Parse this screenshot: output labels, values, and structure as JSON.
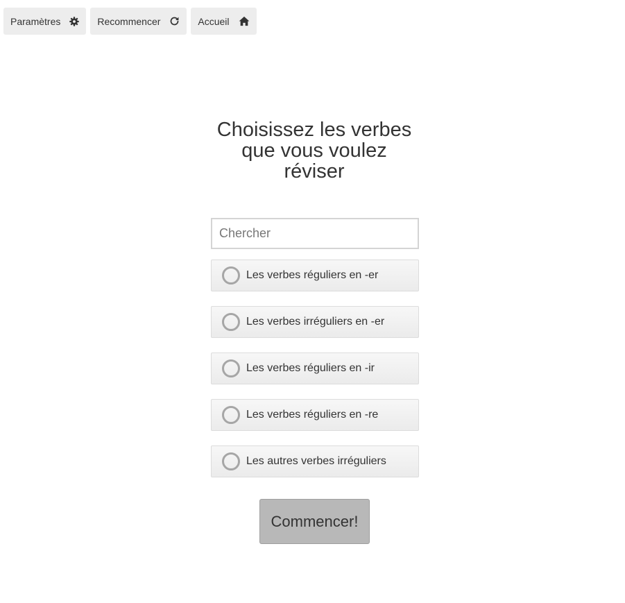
{
  "toolbar": {
    "buttons": [
      {
        "label": "Paramètres",
        "icon": "gear-icon"
      },
      {
        "label": "Recommencer",
        "icon": "refresh-icon"
      },
      {
        "label": "Accueil",
        "icon": "home-icon"
      }
    ]
  },
  "main": {
    "title": "Choisissez les verbes que vous voulez réviser",
    "search": {
      "placeholder": "Chercher",
      "value": ""
    },
    "options": [
      {
        "label": "Les verbes réguliers en -er",
        "selected": false
      },
      {
        "label": "Les verbes irréguliers en -er",
        "selected": false
      },
      {
        "label": "Les verbes réguliers en -ir",
        "selected": false
      },
      {
        "label": "Les verbes réguliers en -re",
        "selected": false
      },
      {
        "label": "Les autres verbes irréguliers",
        "selected": false
      }
    ],
    "start_label": "Commencer!"
  },
  "colors": {
    "toolbar_button_bg": "#ededed",
    "option_bg": "#f0f0f0",
    "radio_ring": "#a6a6a6",
    "start_button_bg": "#b8b8b8",
    "text": "#333333"
  }
}
